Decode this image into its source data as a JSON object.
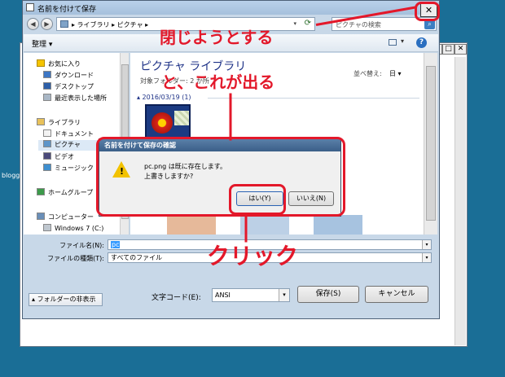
{
  "desktop": {
    "side_text": "blogg"
  },
  "background_window": {
    "min": "_",
    "max": "□",
    "close": "✕"
  },
  "save_dialog": {
    "title": "名前を付けて保存",
    "close_glyph": "✕",
    "address": {
      "back": "◀",
      "forward": "▶",
      "path": "▸ ライブラリ ▸ ピクチャ ▸",
      "chevron": "▾",
      "refresh": "⟳"
    },
    "search_placeholder": "ピクチャの検索",
    "toolbar": {
      "organize": "整理 ▾",
      "view_drop": "▾",
      "help": "?"
    },
    "nav": {
      "favorites": "お気に入り",
      "downloads": "ダウンロード",
      "desktop": "デスクトップ",
      "recent": "最近表示した場所",
      "libraries": "ライブラリ",
      "documents": "ドキュメント",
      "pictures": "ピクチャ",
      "videos": "ビデオ",
      "music": "ミュージック",
      "homegroup": "ホームグループ",
      "computer": "コンピューター",
      "windows_drive": "Windows 7 (C:)"
    },
    "content": {
      "library_title": "ピクチャ ライブラリ",
      "library_subtitle": "対象フォルダー: 2 か所",
      "sort_label": "並べ替え:",
      "sort_value": "日 ▾",
      "group_header": "▴ 2016/03/19 (1)"
    },
    "filename_label": "ファイル名(N):",
    "filename_value": "pc",
    "filetype_label": "ファイルの種類(T):",
    "filetype_value": "すべてのファイル",
    "dropdown_glyph": "▾",
    "hide_folders": "フォルダーの非表示",
    "charset_label": "文字コード(E):",
    "charset_value": "ANSI",
    "save_button": "保存(S)",
    "cancel_button": "キャンセル"
  },
  "confirm_dialog": {
    "title": "名前を付けて保存の確認",
    "message_line1": "pc.png は既に存在します。",
    "message_line2": "上書きしますか?",
    "warn_mark": "!",
    "yes_button": "はい(Y)",
    "no_button": "いいえ(N)"
  },
  "annotations": {
    "close_note": "閉じようとする",
    "appear_note": "と、これが出る",
    "click_note": "クリック",
    "color": "#e3182a"
  }
}
